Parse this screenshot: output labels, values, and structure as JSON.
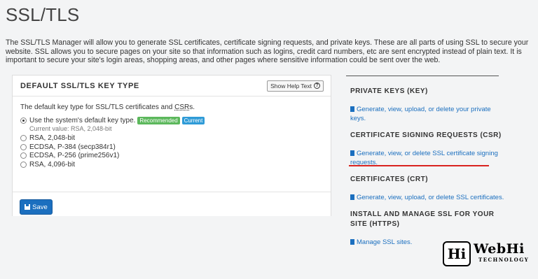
{
  "page": {
    "title": "SSL/TLS",
    "intro": "The SSL/TLS Manager will allow you to generate SSL certificates, certificate signing requests, and private keys. These are all parts of using SSL to secure your website. SSL allows you to secure pages on your site so that information such as logins, credit card numbers, etc are sent encrypted instead of plain text. It is important to secure your site's login areas, shopping areas, and other pages where sensitive information could be sent over the web."
  },
  "key_type_panel": {
    "title": "DEFAULT SSL/TLS KEY TYPE",
    "help_button": "Show Help Text",
    "description_prefix": "The default key type for SSL/TLS certificates and ",
    "description_abbr": "CSR",
    "description_suffix": "s.",
    "options": [
      {
        "label": "Use the system's default key type.",
        "checked": true
      },
      {
        "label": "RSA, 2,048-bit",
        "checked": false
      },
      {
        "label": "ECDSA, P-384 (secp384r1)",
        "checked": false
      },
      {
        "label": "ECDSA, P-256 (prime256v1)",
        "checked": false
      },
      {
        "label": "RSA, 4,096-bit",
        "checked": false
      }
    ],
    "badge_recommended": "Recommended",
    "badge_current": "Current",
    "current_value": "Current value: RSA, 2,048-bit",
    "save_label": "Save"
  },
  "sections": [
    {
      "title": "PRIVATE KEYS (KEY)",
      "link": "Generate, view, upload, or delete your private keys."
    },
    {
      "title": "CERTIFICATE SIGNING REQUESTS (CSR)",
      "link": "Generate, view, or delete SSL certificate signing requests."
    },
    {
      "title": "CERTIFICATES (CRT)",
      "link": "Generate, view, upload, or delete SSL certificates."
    },
    {
      "title": "INSTALL AND MANAGE SSL FOR YOUR SITE (HTTPS)",
      "link": "Manage SSL sites."
    }
  ],
  "logo": {
    "mark": "Hi",
    "word": "WebHi",
    "sub": "TECHNOLOGY"
  },
  "colors": {
    "accent": "#1b6fbf",
    "badge_green": "#5cb85c",
    "badge_blue": "#2f9bd7",
    "highlight": "#d9231f"
  }
}
